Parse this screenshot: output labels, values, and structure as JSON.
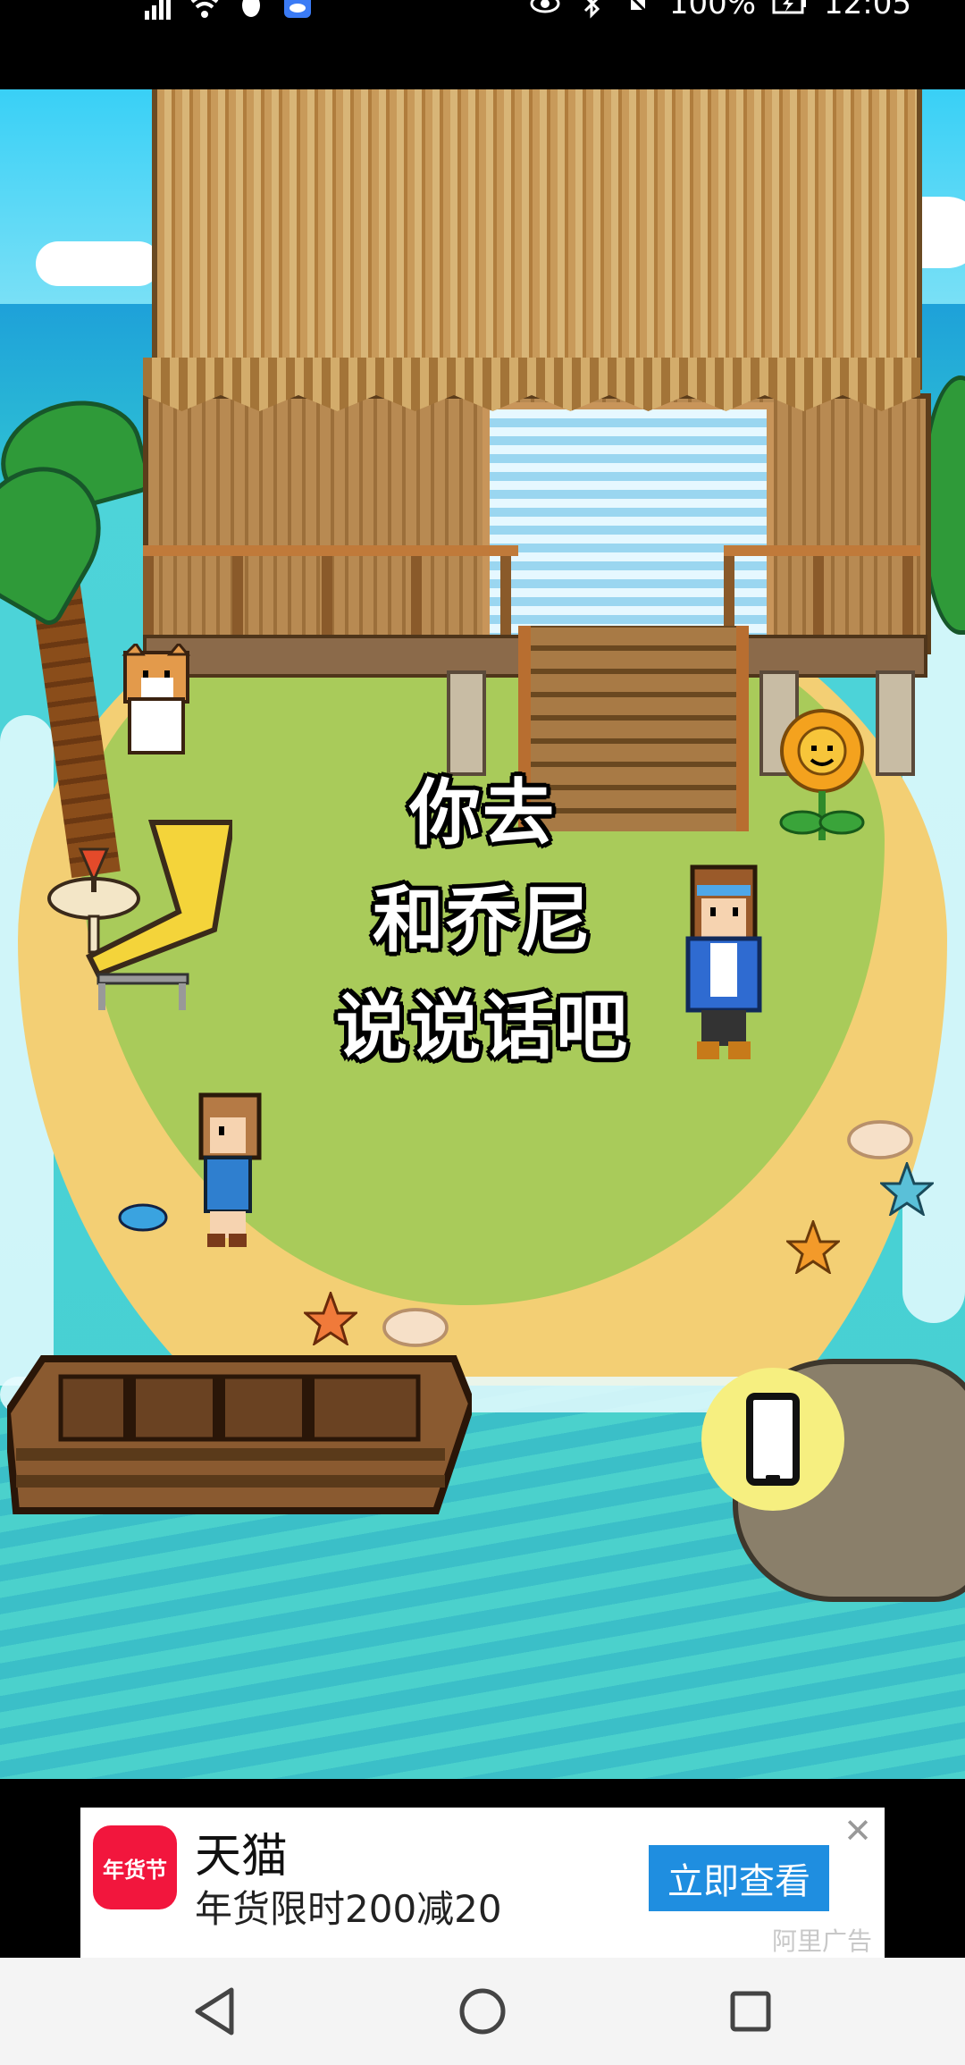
{
  "status_bar": {
    "battery_text": "100%",
    "time": "12:05"
  },
  "game": {
    "dialog_lines": [
      "你去",
      "和乔尼",
      "说说话吧"
    ],
    "phone_button_icon": "phone-icon"
  },
  "ad": {
    "logo_text": "年货节",
    "title": "天猫",
    "subtitle": "年货限时200减20",
    "cta": "立即查看",
    "close": "✕",
    "source": "阿里广告",
    "colors": {
      "logo_bg": "#f2163d",
      "cta_bg": "#1f8ee0"
    }
  },
  "nav": {
    "back_icon": "back-triangle-icon",
    "home_icon": "home-circle-icon",
    "recents_icon": "recents-square-icon"
  }
}
